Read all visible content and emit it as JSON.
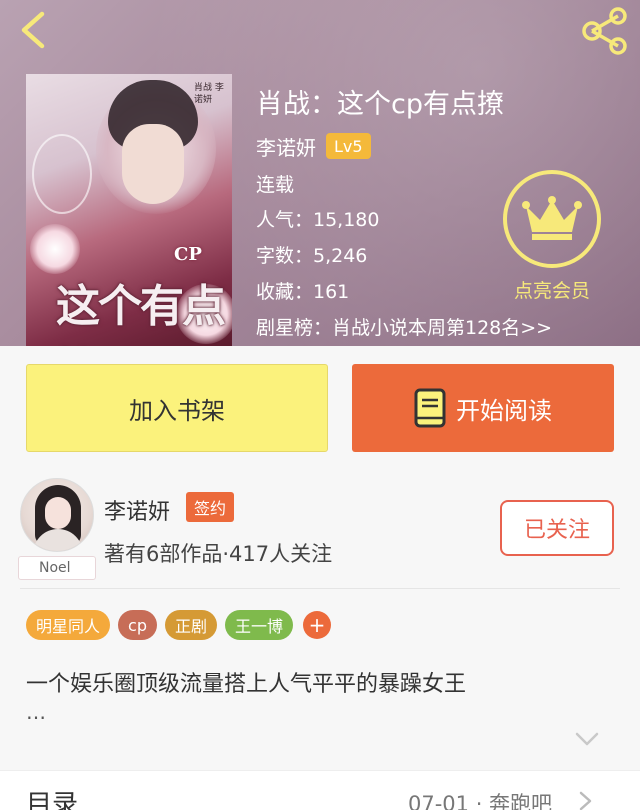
{
  "book": {
    "title": "肖战：这个cp有点撩",
    "author": "李诺妍",
    "author_level": "Lv5",
    "status": "连载",
    "popularity_label": "人气：15,180",
    "word_count_label": "字数：5,246",
    "favorites_label": "收藏：161",
    "ranking_label": "剧星榜：肖战小说本周第128名>>",
    "cover_title": "这个有点撩",
    "cover_cp": "CP",
    "cover_author_tag": "肖战 李诺妍"
  },
  "vip": {
    "label": "点亮会员",
    "icon": "crown-icon"
  },
  "actions": {
    "add_shelf_label": "加入书架",
    "start_read_label": "开始阅读"
  },
  "author_card": {
    "name": "李诺妍",
    "badge": "签约",
    "stats": "著有6部作品·417人关注",
    "avatar_tag": "Noel",
    "follow_label": "已关注"
  },
  "tags": [
    {
      "label": "明星同人",
      "color": "#f4a93b"
    },
    {
      "label": "cp",
      "color": "#c76d57"
    },
    {
      "label": "正剧",
      "color": "#d59a35"
    },
    {
      "label": "王一博",
      "color": "#7fba4c"
    }
  ],
  "tag_more_label": "+",
  "description": {
    "text": "一个娱乐圈顶级流量搭上人气平平的暴躁女王",
    "ellipsis": "…"
  },
  "toc": {
    "label": "目录",
    "latest": "07-01 · 奔跑吧"
  },
  "colors": {
    "accent_orange": "#ec6a3b",
    "shelf_yellow": "#fbf27c",
    "vip_yellow": "#f7e97a",
    "level_badge": "#f4b93a"
  }
}
